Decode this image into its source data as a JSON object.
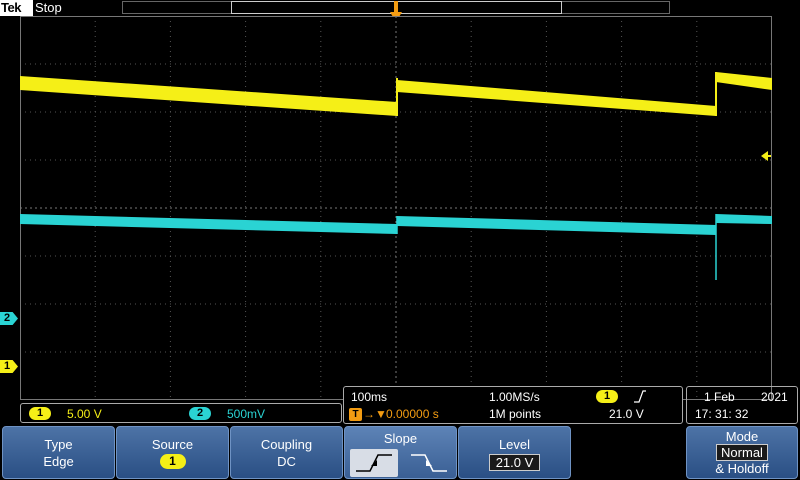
{
  "header": {
    "brand": "Tek",
    "acq_state": "Stop"
  },
  "markers": {
    "trigger_position": "T",
    "ch1": "1",
    "ch2": "2"
  },
  "channels": [
    {
      "id": "1",
      "scale": "5.00 V",
      "color": "#f5ef17"
    },
    {
      "id": "2",
      "scale": "500mV",
      "color": "#2ad3d3"
    }
  ],
  "horizontal": {
    "time_per_div": "100ms",
    "sample_rate": "1.00MS/s",
    "record_length": "1M points",
    "delay_icon": "T",
    "delay_arrow": "→▼",
    "delay": "0.00000 s"
  },
  "trigger": {
    "source": "1",
    "slope": "rising",
    "level": "21.0 V",
    "trigger_color": "#f39c12"
  },
  "datetime": {
    "date_day": "1 Feb",
    "date_year": "2021",
    "time": "17: 31: 32"
  },
  "menu": {
    "type_label": "Type",
    "type_value": "Edge",
    "source_label": "Source",
    "source_value": "1",
    "coupling_label": "Coupling",
    "coupling_value": "DC",
    "slope_label": "Slope",
    "level_label": "Level",
    "level_value": "21.0 V",
    "mode_label": "Mode",
    "mode_value_line1": "Normal",
    "mode_value_line2": "& Holdoff"
  },
  "icons": {
    "trigger_position_marker": "orange-down-arrow-icon",
    "trigger_level_marker": "yellow-left-arrow-icon",
    "slope_rising": "rising-edge-icon",
    "slope_falling": "falling-edge-icon"
  }
}
